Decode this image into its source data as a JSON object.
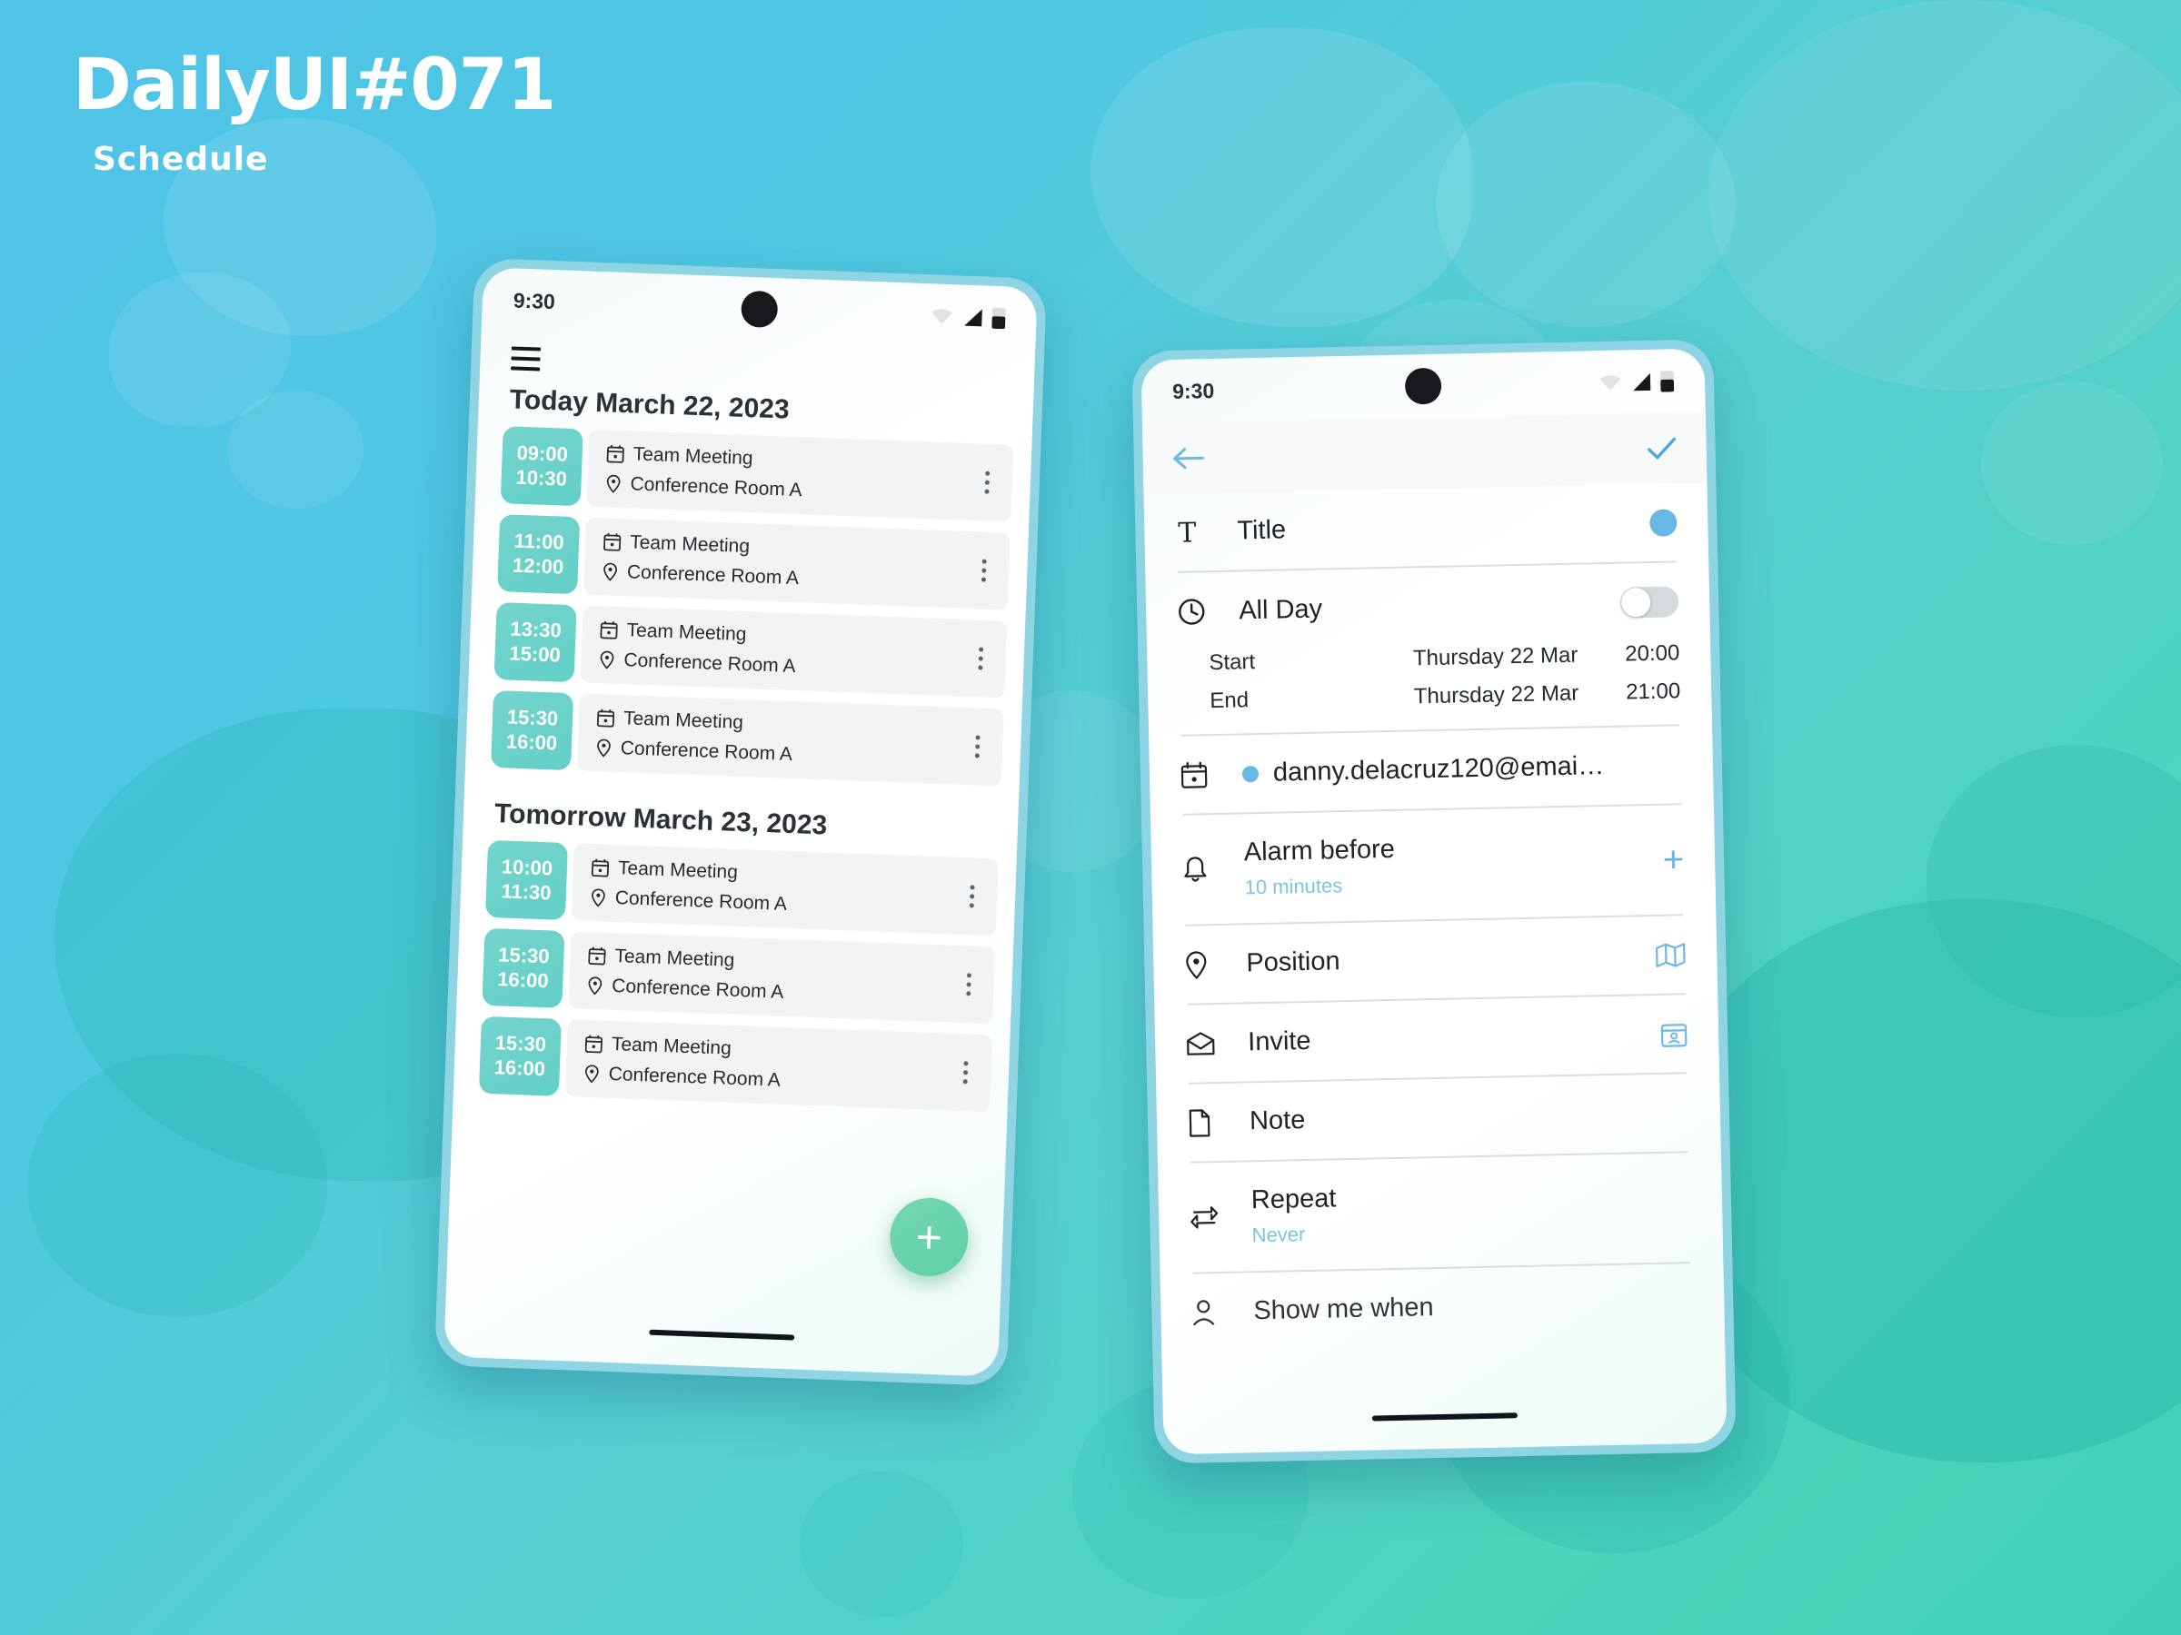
{
  "page": {
    "main_title": "DailyUI#071",
    "sub_title": "Schedule"
  },
  "phone_schedule": {
    "status": {
      "time": "9:30",
      "wifi_icon": "wifi-icon",
      "signal_icon": "signal-icon",
      "battery_icon": "battery-icon"
    },
    "menu_icon": "hamburger-menu-icon",
    "fab_label": "+",
    "sections": [
      {
        "header": "Today March 22, 2023",
        "events": [
          {
            "start": "09:00",
            "end": "10:30",
            "title": "Team Meeting",
            "location": "Conference Room A"
          },
          {
            "start": "11:00",
            "end": "12:00",
            "title": "Team Meeting",
            "location": "Conference Room A"
          },
          {
            "start": "13:30",
            "end": "15:00",
            "title": "Team Meeting",
            "location": "Conference Room A"
          },
          {
            "start": "15:30",
            "end": "16:00",
            "title": "Team Meeting",
            "location": "Conference Room A"
          }
        ]
      },
      {
        "header": "Tomorrow March 23, 2023",
        "events": [
          {
            "start": "10:00",
            "end": "11:30",
            "title": "Team Meeting",
            "location": "Conference Room A"
          },
          {
            "start": "15:30",
            "end": "16:00",
            "title": "Team Meeting",
            "location": "Conference Room A"
          },
          {
            "start": "15:30",
            "end": "16:00",
            "title": "Team Meeting",
            "location": "Conference Room A"
          }
        ]
      }
    ]
  },
  "phone_detail": {
    "status": {
      "time": "9:30",
      "wifi_icon": "wifi-icon",
      "signal_icon": "signal-icon",
      "battery_icon": "battery-icon"
    },
    "appbar": {
      "back_icon": "arrow-left-icon",
      "confirm_icon": "check-icon"
    },
    "title_row": {
      "icon": "text-format-icon",
      "label": "Title",
      "color_swatch": "#69b7e5"
    },
    "allday_row": {
      "icon": "clock-icon",
      "label": "All Day",
      "toggle_on": false
    },
    "start_row": {
      "label": "Start",
      "date": "Thursday 22 Mar",
      "time": "20:00"
    },
    "end_row": {
      "label": "End",
      "date": "Thursday 22 Mar",
      "time": "21:00"
    },
    "calendar_row": {
      "icon": "calendar-icon",
      "email": "danny.delacruz120@emai…",
      "dot_color": "#69b7e5"
    },
    "alarm_row": {
      "icon": "bell-icon",
      "label": "Alarm before",
      "value": "10 minutes",
      "add_icon": "plus-icon"
    },
    "position_row": {
      "icon": "location-pin-icon",
      "label": "Position",
      "trailing_icon": "map-icon"
    },
    "invite_row": {
      "icon": "mail-open-icon",
      "label": "Invite",
      "trailing_icon": "calendar-person-icon"
    },
    "note_row": {
      "icon": "document-icon",
      "label": "Note"
    },
    "repeat_row": {
      "icon": "repeat-icon",
      "label": "Repeat",
      "value": "Never"
    },
    "showme_row": {
      "icon": "person-icon",
      "label": "Show me when"
    }
  }
}
